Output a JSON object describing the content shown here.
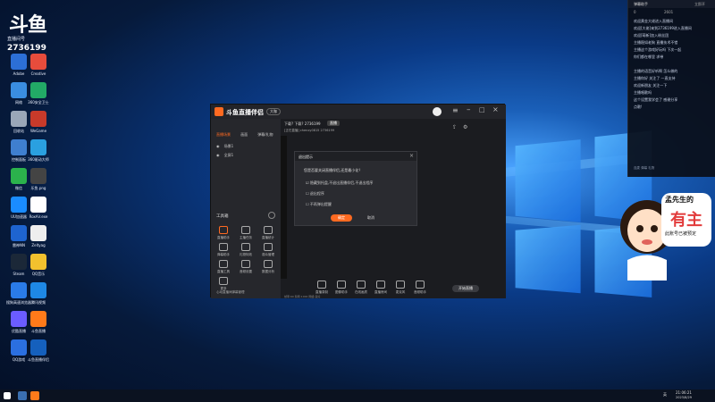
{
  "brand": {
    "logo_text": "斗鱼",
    "room_label": "直播间号",
    "room_number": "2736199"
  },
  "desktop_icons": [
    {
      "label": "Adobe",
      "color": "#2c6fd6"
    },
    {
      "label": "Creative",
      "color": "#e74c3c"
    },
    {
      "label": "网络",
      "color": "#3a8de0"
    },
    {
      "label": "360安全卫士",
      "color": "#22aa66"
    },
    {
      "label": "回收站",
      "color": "#9aa7b8"
    },
    {
      "label": "WeGame",
      "color": "#c83a2a"
    },
    {
      "label": "控制面板",
      "color": "#3f7fcf"
    },
    {
      "label": "360驱动大师",
      "color": "#2aa0e0"
    },
    {
      "label": "微信",
      "color": "#2bb24c"
    },
    {
      "label": "乐鱼.png",
      "color": "#444"
    },
    {
      "label": "UU加速器",
      "color": "#1a8cff"
    },
    {
      "label": "RoxAir.exe",
      "color": "#ffffff"
    },
    {
      "label": "雷神NN",
      "color": "#1e64d0"
    },
    {
      "label": "Zeltyag",
      "color": "#eeeeee"
    },
    {
      "label": "Steam",
      "color": "#1b2838"
    },
    {
      "label": "QQ音乐",
      "color": "#f2c12e"
    },
    {
      "label": "搜狗高速浏览器",
      "color": "#2a7be8"
    },
    {
      "label": "腾讯视频",
      "color": "#1e88e5"
    },
    {
      "label": "优酷直播",
      "color": "#6b5cff"
    },
    {
      "label": "斗鱼直播",
      "color": "#ff7a1a"
    },
    {
      "label": "QQ游戏",
      "color": "#2b6fe0"
    },
    {
      "label": "斗鱼直播伴侣",
      "color": "#1560bd"
    }
  ],
  "app": {
    "title": "斗鱼直播伴侣",
    "badge": "大咖",
    "left_tabs": [
      "直播场景",
      "画面",
      "弹幕/礼物"
    ],
    "scene_items": [
      "场景1",
      "全屏1"
    ],
    "toolbox_title": "工具箱",
    "tools": [
      {
        "label": "直播助手"
      },
      {
        "label": "主播任务"
      },
      {
        "label": "直播统计"
      },
      {
        "label": "弹幕助手"
      },
      {
        "label": "礼物特效"
      },
      {
        "label": "观众管理"
      },
      {
        "label": "直播工具"
      },
      {
        "label": "音频设置"
      },
      {
        "label": "数据分析"
      },
      {
        "label": "更多"
      }
    ],
    "left_bottom_text": "心动直播间弹幕管理",
    "main_header": {
      "line1": "下载?  下载?  2736199",
      "tag": "直播",
      "sub": "[正在直播]   chenxy0815   2736199"
    },
    "bottom_tools": [
      {
        "label": "直播录制"
      },
      {
        "label": "图像助手"
      },
      {
        "label": "在线画质"
      },
      {
        "label": "直播房间"
      },
      {
        "label": "麦克风"
      },
      {
        "label": "音频助手"
      }
    ],
    "start_button": "开始直播",
    "status_text": "帧率:60  码率:1000  网络:良好"
  },
  "dialog": {
    "title": "退出提示",
    "question": "您是否要关闭直播伴侣,还是最小化？",
    "options": [
      {
        "label": "隐藏到托盘,不退出直播伴侣,不退出程序",
        "checked": true
      },
      {
        "label": "退出程序",
        "checked": false
      },
      {
        "label": "不再弹出提醒",
        "checked": false
      }
    ],
    "ok_label": "确定",
    "cancel_label": "取消"
  },
  "chat": {
    "title": "弹幕助手",
    "counts": [
      "0",
      "2601",
      "立即开"
    ],
    "messages": [
      "欢迎黄金大佬进入直播间",
      "欢迎[大佬]来到2736199进入直播间",
      "欢迎[萌新]加入粉丝团",
      "主播稳如老狗 直播技术不错",
      "主播这个游戏好玩吗 下次一起",
      "你们都在哪里 求带",
      "主播的语音好听啊 怎么做的",
      "主播你好 关注了 一直支持",
      "欢迎新朋友 关注一下",
      "主播唱歌吗",
      "这个设置我学会了 感谢分享",
      "点歌!"
    ],
    "footer": "连麦 弹幕 礼物"
  },
  "sticker": {
    "caption_top": "孟先生的",
    "caption_mid": "有主",
    "caption_bot": "此账号已被预定"
  },
  "taskbar": {
    "clock_time": "21:06:21",
    "clock_date": "2023/8/29",
    "lang": "英"
  }
}
